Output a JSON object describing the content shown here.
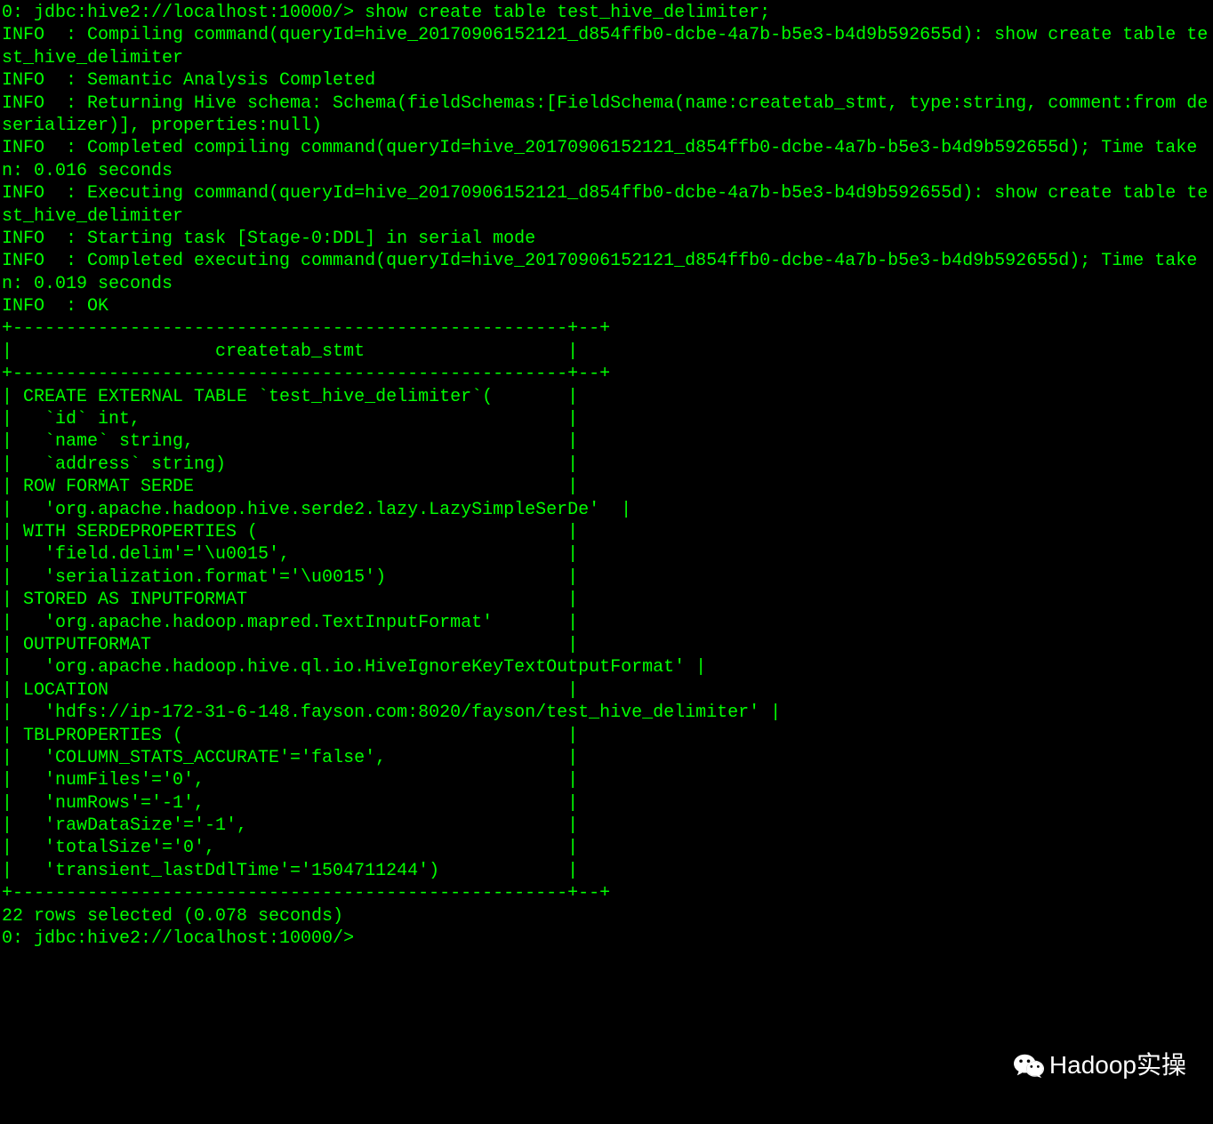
{
  "terminal": {
    "lines": [
      "0: jdbc:hive2://localhost:10000/> show create table test_hive_delimiter;",
      "INFO  : Compiling command(queryId=hive_20170906152121_d854ffb0-dcbe-4a7b-b5e3-b4d9b592655d): show create table test_hive_delimiter",
      "INFO  : Semantic Analysis Completed",
      "INFO  : Returning Hive schema: Schema(fieldSchemas:[FieldSchema(name:createtab_stmt, type:string, comment:from deserializer)], properties:null)",
      "INFO  : Completed compiling command(queryId=hive_20170906152121_d854ffb0-dcbe-4a7b-b5e3-b4d9b592655d); Time taken: 0.016 seconds",
      "INFO  : Executing command(queryId=hive_20170906152121_d854ffb0-dcbe-4a7b-b5e3-b4d9b592655d): show create table test_hive_delimiter",
      "INFO  : Starting task [Stage-0:DDL] in serial mode",
      "INFO  : Completed executing command(queryId=hive_20170906152121_d854ffb0-dcbe-4a7b-b5e3-b4d9b592655d); Time taken: 0.019 seconds",
      "INFO  : OK",
      "+----------------------------------------------------+--+",
      "|                   createtab_stmt                   |",
      "+----------------------------------------------------+--+",
      "| CREATE EXTERNAL TABLE `test_hive_delimiter`(       |",
      "|   `id` int,                                        |",
      "|   `name` string,                                   |",
      "|   `address` string)                                |",
      "| ROW FORMAT SERDE                                   |",
      "|   'org.apache.hadoop.hive.serde2.lazy.LazySimpleSerDe'  |",
      "| WITH SERDEPROPERTIES (                             |",
      "|   'field.delim'='\\u0015',                          |",
      "|   'serialization.format'='\\u0015')                 |",
      "| STORED AS INPUTFORMAT                              |",
      "|   'org.apache.hadoop.mapred.TextInputFormat'       |",
      "| OUTPUTFORMAT                                       |",
      "|   'org.apache.hadoop.hive.ql.io.HiveIgnoreKeyTextOutputFormat' |",
      "| LOCATION                                           |",
      "|   'hdfs://ip-172-31-6-148.fayson.com:8020/fayson/test_hive_delimiter' |",
      "| TBLPROPERTIES (                                    |",
      "|   'COLUMN_STATS_ACCURATE'='false',                 |",
      "|   'numFiles'='0',                                  |",
      "|   'numRows'='-1',                                  |",
      "|   'rawDataSize'='-1',                              |",
      "|   'totalSize'='0',                                 |",
      "|   'transient_lastDdlTime'='1504711244')            |",
      "+----------------------------------------------------+--+",
      "22 rows selected (0.078 seconds)",
      "0: jdbc:hive2://localhost:10000/>"
    ]
  },
  "watermark": {
    "text": "Hadoop实操"
  }
}
